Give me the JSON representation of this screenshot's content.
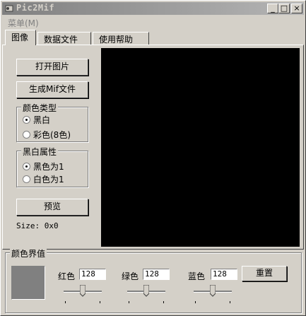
{
  "window": {
    "title": "Pic2Mif"
  },
  "menu": {
    "items": [
      "菜单(M)"
    ]
  },
  "tabs": [
    "图像",
    "数据文件",
    "使用帮助"
  ],
  "image_tab": {
    "open_button": "打开图片",
    "generate_button": "生成Mif文件",
    "color_type": {
      "title": "颜色类型",
      "options": [
        "黑白",
        "彩色(8色)"
      ],
      "selected": 0
    },
    "bw_property": {
      "title": "黑白属性",
      "options": [
        "黑色为1",
        "白色为1"
      ],
      "selected": 0
    },
    "preview_button": "预览",
    "size_text": "Size: 0x0"
  },
  "threshold": {
    "title": "颜色界值",
    "swatch_color": "#808080",
    "red": {
      "label": "红色",
      "value": "128",
      "fraction": 0.5
    },
    "green": {
      "label": "绿色",
      "value": "128",
      "fraction": 0.5
    },
    "blue": {
      "label": "蓝色",
      "value": "128",
      "fraction": 0.5
    },
    "reset_button": "重置"
  },
  "colors": {
    "preview_bg": "#000000",
    "face": "#d4d0c8"
  }
}
